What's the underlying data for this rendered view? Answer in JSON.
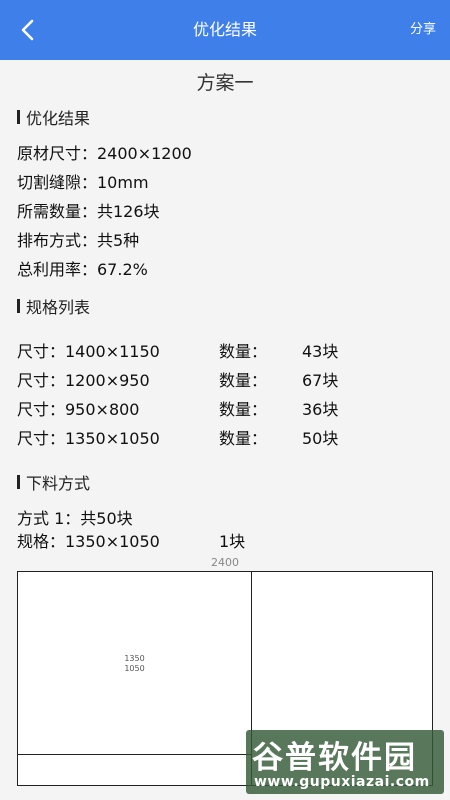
{
  "header": {
    "title": "优化结果",
    "share_label": "分享",
    "back_icon": "chevron-left-icon"
  },
  "plan_title": "方案一",
  "summary": {
    "heading": "优化结果",
    "lines": [
      "原材尺寸：2400×1200",
      "切割缝隙：10mm",
      "所需数量：共126块",
      "排布方式：共5种",
      "总利用率：67.2%"
    ]
  },
  "specs": {
    "heading": "规格列表",
    "rows": [
      {
        "size": "尺寸：1400×1150",
        "qty_label": "数量：",
        "qty": "43块"
      },
      {
        "size": "尺寸：1200×950",
        "qty_label": "数量：",
        "qty": "67块"
      },
      {
        "size": "尺寸：950×800",
        "qty_label": "数量：",
        "qty": "36块"
      },
      {
        "size": "尺寸：1350×1050",
        "qty_label": "数量：",
        "qty": "50块"
      }
    ]
  },
  "cutting": {
    "heading": "下料方式",
    "mode": "方式 1：共50块",
    "spec": "规格：1350×1050",
    "spec_count": "1块",
    "board_width": "2400",
    "piece_w": "1350",
    "piece_h": "1050"
  },
  "watermark": {
    "big": "谷普软件园",
    "small": "www.gupuxiazai.com"
  }
}
